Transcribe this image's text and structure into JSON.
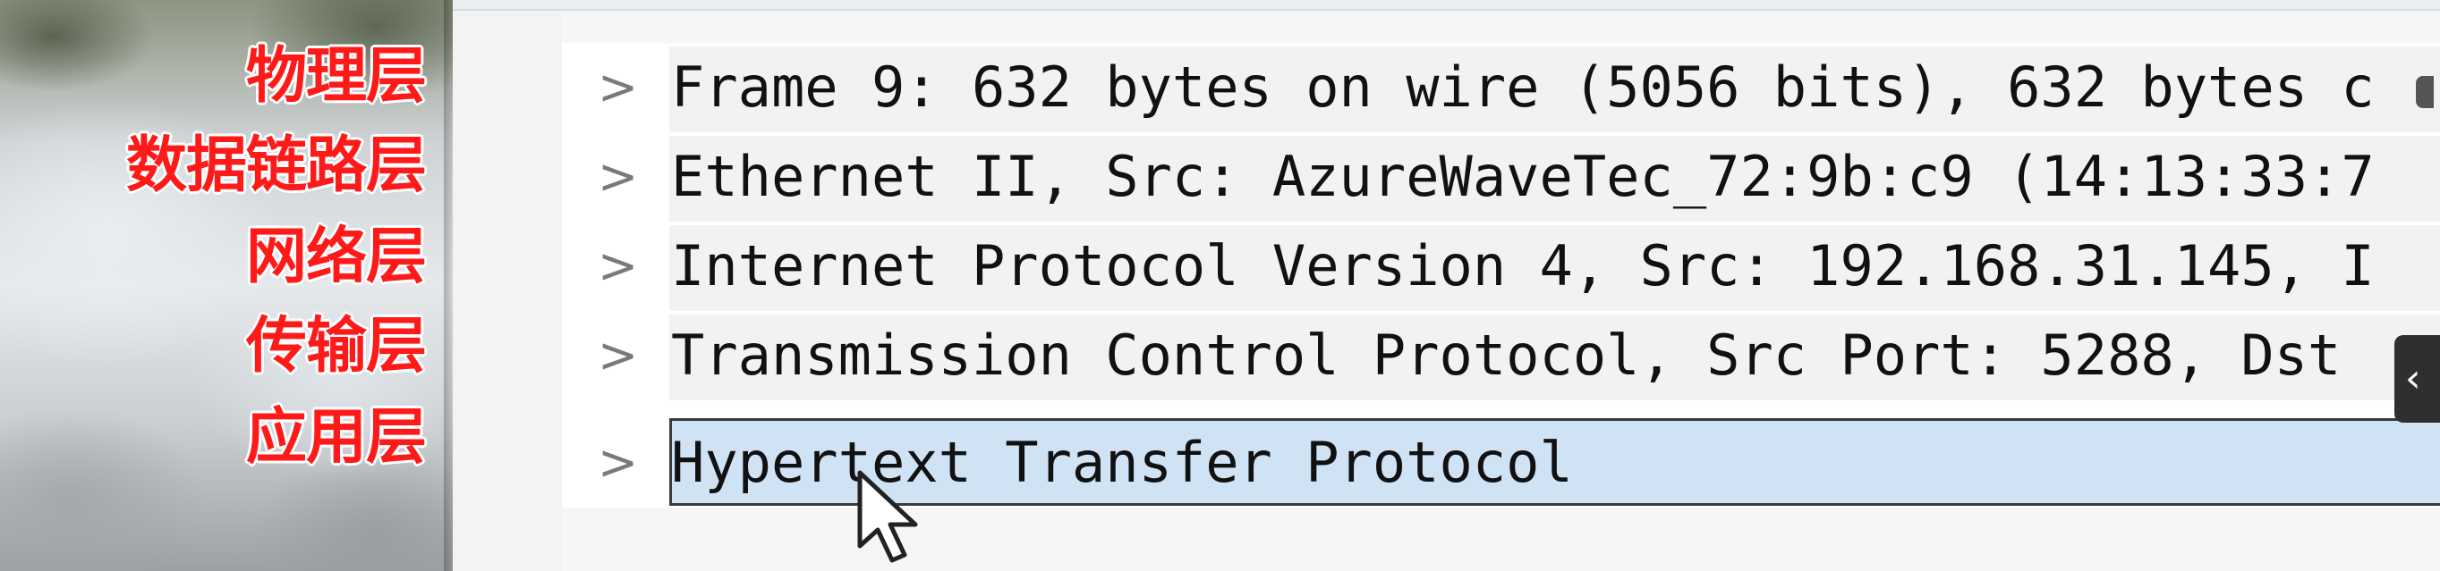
{
  "layer_labels": [
    "物理层",
    "数据链路层",
    "网络层",
    "传输层",
    "应用层"
  ],
  "packet_tree": {
    "rows": [
      {
        "expander": ">",
        "text": "Frame 9: 632 bytes on wire (5056 bits), 632 bytes c"
      },
      {
        "expander": ">",
        "text": "Ethernet II, Src: AzureWaveTec_72:9b:c9 (14:13:33:7"
      },
      {
        "expander": ">",
        "text": "Internet Protocol Version 4, Src: 192.168.31.145, I"
      },
      {
        "expander": ">",
        "text": "Transmission Control Protocol, Src Port: 5288, Dst"
      },
      {
        "expander": ">",
        "text": "Hypertext Transfer Protocol"
      }
    ],
    "selected_row": 4
  },
  "side_tab_glyph": "‹",
  "colors": {
    "label_red": "#ff1a1a",
    "selection": "#cfe3f5"
  }
}
